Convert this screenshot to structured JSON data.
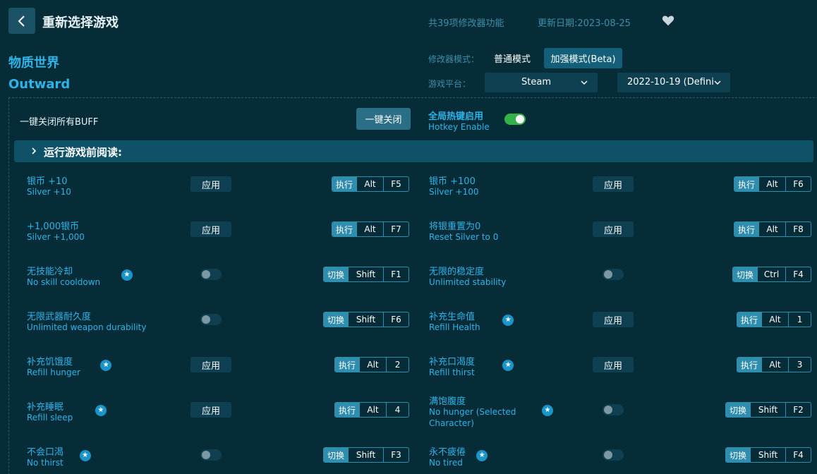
{
  "header": {
    "title": "重新选择游戏",
    "feature_count": "共39项修改器功能",
    "update_date": "更新日期:2023-08-25"
  },
  "game": {
    "name_cn": "物质世界",
    "name_en": "Outward"
  },
  "mode": {
    "label": "修改器模式：",
    "normal": "普通模式",
    "beta": "加强模式(Beta)"
  },
  "platform": {
    "label": "游戏平台：",
    "selected": "Steam",
    "version": "2022-10-19 (Defini"
  },
  "global": {
    "buff_label": "一键关闭所有BUFF",
    "close_all": "一键关闭",
    "hotkey_cn": "全局热键启用",
    "hotkey_en": "Hotkey Enable",
    "hotkey_enabled": true
  },
  "read_before": "运行游戏前阅读:",
  "items": [
    {
      "cn": "银币 +10",
      "en": "Silver +10",
      "control": "apply",
      "control_label": "应用",
      "action": "执行",
      "keys": [
        "Alt",
        "F5"
      ],
      "star": false
    },
    {
      "cn": "银币 +100",
      "en": "Silver +100",
      "control": "apply",
      "control_label": "应用",
      "action": "执行",
      "keys": [
        "Alt",
        "F6"
      ],
      "star": false
    },
    {
      "cn": "+1,000银币",
      "en": "Silver +1,000",
      "control": "apply",
      "control_label": "应用",
      "action": "执行",
      "keys": [
        "Alt",
        "F7"
      ],
      "star": false
    },
    {
      "cn": "将银重置为0",
      "en": "Reset Silver to 0",
      "control": "apply",
      "control_label": "应用",
      "action": "执行",
      "keys": [
        "Alt",
        "F8"
      ],
      "star": false
    },
    {
      "cn": "无技能冷却",
      "en": "No skill cooldown",
      "control": "toggle",
      "action": "切换",
      "keys": [
        "Shift",
        "F1"
      ],
      "star": true
    },
    {
      "cn": "无限的稳定度",
      "en": "Unlimited stability",
      "control": "toggle",
      "action": "切换",
      "keys": [
        "Ctrl",
        "F4"
      ],
      "star": false
    },
    {
      "cn": "无限武器耐久度",
      "en": "Unlimited weapon durability",
      "control": "toggle",
      "action": "切换",
      "keys": [
        "Shift",
        "F6"
      ],
      "star": false
    },
    {
      "cn": "补充生命值",
      "en": "Refill Health",
      "control": "apply",
      "control_label": "应用",
      "action": "执行",
      "keys": [
        "Alt",
        "1"
      ],
      "star": true
    },
    {
      "cn": "补充饥饿度",
      "en": "Refill hunger",
      "control": "apply",
      "control_label": "应用",
      "action": "执行",
      "keys": [
        "Alt",
        "2"
      ],
      "star": true
    },
    {
      "cn": "补充口渴度",
      "en": "Refill thirst",
      "control": "apply",
      "control_label": "应用",
      "action": "执行",
      "keys": [
        "Alt",
        "3"
      ],
      "star": true
    },
    {
      "cn": "补充睡眠",
      "en": "Refill sleep",
      "control": "apply",
      "control_label": "应用",
      "action": "执行",
      "keys": [
        "Alt",
        "4"
      ],
      "star": true
    },
    {
      "cn": "满饱腹度",
      "en": "No hunger (Selected Character)",
      "control": "toggle",
      "action": "切换",
      "keys": [
        "Shift",
        "F2"
      ],
      "star": true
    },
    {
      "cn": "不会口渴",
      "en": "No thirst",
      "control": "toggle",
      "action": "切换",
      "keys": [
        "Shift",
        "F3"
      ],
      "star": true
    },
    {
      "cn": "永不疲倦",
      "en": "No tired",
      "control": "toggle",
      "action": "切换",
      "keys": [
        "Shift",
        "F4"
      ],
      "star": true
    }
  ]
}
